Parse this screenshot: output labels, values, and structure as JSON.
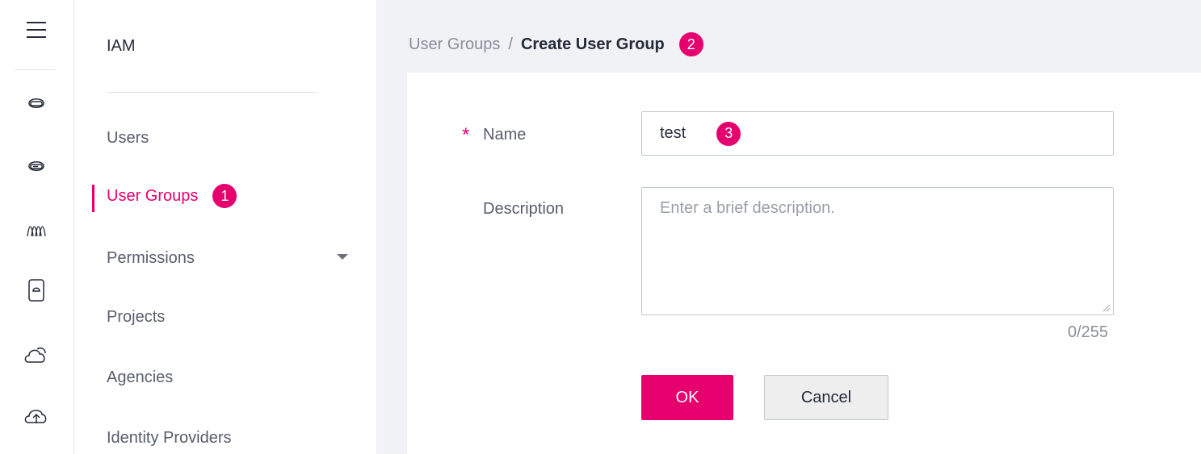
{
  "rail": {
    "icons": [
      "hamburger-menu-icon",
      "ecs-icon",
      "bms-icon",
      "cce-icon",
      "obs-icon",
      "cloud-icon",
      "cloud-upload-icon"
    ]
  },
  "nav": {
    "title": "IAM",
    "items": [
      {
        "label": "Users"
      },
      {
        "label": "User Groups",
        "active": true,
        "badge": "1"
      },
      {
        "label": "Permissions",
        "has_dropdown": true
      },
      {
        "label": "Projects"
      },
      {
        "label": "Agencies"
      },
      {
        "label": "Identity Providers"
      }
    ]
  },
  "breadcrumb": {
    "parent": "User Groups",
    "separator": "/",
    "current": "Create User Group",
    "badge": "2"
  },
  "form": {
    "required_mark": "*",
    "name_label": "Name",
    "name_value": "test",
    "name_badge": "3",
    "description_label": "Description",
    "description_placeholder": "Enter a brief description.",
    "counter": "0/255",
    "ok_label": "OK",
    "cancel_label": "Cancel"
  },
  "colors": {
    "accent": "#e6006e",
    "page_bg": "#f1f2f6",
    "text": "#252b3a",
    "muted_text": "#8a8e99"
  }
}
